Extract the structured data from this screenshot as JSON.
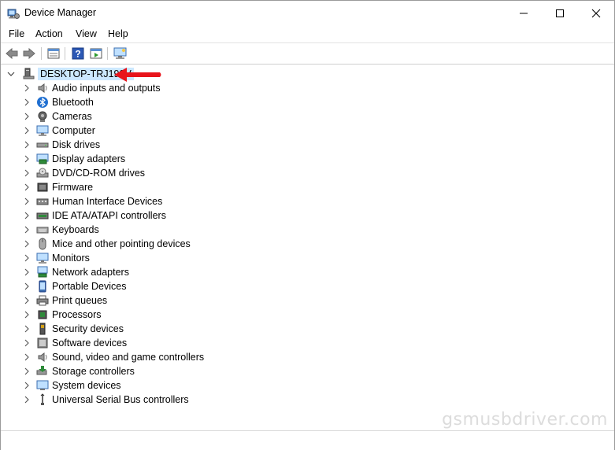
{
  "window": {
    "title": "Device Manager",
    "minimize_icon": "minimize-icon",
    "maximize_icon": "maximize-icon",
    "close_icon": "close-icon"
  },
  "menu": [
    "File",
    "Action",
    "View",
    "Help"
  ],
  "toolbar": [
    "back-icon",
    "forward-icon",
    "properties-icon",
    "help-icon",
    "run-icon",
    "scan-hardware-icon"
  ],
  "tree": {
    "root": "DESKTOP-TRJ192V",
    "categories": [
      {
        "label": "Audio inputs and outputs",
        "icon": "speaker-icon"
      },
      {
        "label": "Bluetooth",
        "icon": "bluetooth-icon"
      },
      {
        "label": "Cameras",
        "icon": "camera-icon"
      },
      {
        "label": "Computer",
        "icon": "computer-icon"
      },
      {
        "label": "Disk drives",
        "icon": "disk-drive-icon"
      },
      {
        "label": "Display adapters",
        "icon": "display-adapter-icon"
      },
      {
        "label": "DVD/CD-ROM drives",
        "icon": "dvd-icon"
      },
      {
        "label": "Firmware",
        "icon": "firmware-icon"
      },
      {
        "label": "Human Interface Devices",
        "icon": "hid-icon"
      },
      {
        "label": "IDE ATA/ATAPI controllers",
        "icon": "ide-controller-icon"
      },
      {
        "label": "Keyboards",
        "icon": "keyboard-icon"
      },
      {
        "label": "Mice and other pointing devices",
        "icon": "mouse-icon"
      },
      {
        "label": "Monitors",
        "icon": "monitor-icon"
      },
      {
        "label": "Network adapters",
        "icon": "network-icon"
      },
      {
        "label": "Portable Devices",
        "icon": "portable-device-icon"
      },
      {
        "label": "Print queues",
        "icon": "printer-icon"
      },
      {
        "label": "Processors",
        "icon": "processor-icon"
      },
      {
        "label": "Security devices",
        "icon": "security-device-icon"
      },
      {
        "label": "Software devices",
        "icon": "software-device-icon"
      },
      {
        "label": "Sound, video and game controllers",
        "icon": "sound-icon"
      },
      {
        "label": "Storage controllers",
        "icon": "storage-controller-icon"
      },
      {
        "label": "System devices",
        "icon": "system-device-icon"
      },
      {
        "label": "Universal Serial Bus controllers",
        "icon": "usb-icon"
      }
    ]
  },
  "watermark": "gsmusbdriver.com",
  "colors": {
    "selection": "#cce8ff",
    "annotation_arrow": "#e8141b"
  }
}
